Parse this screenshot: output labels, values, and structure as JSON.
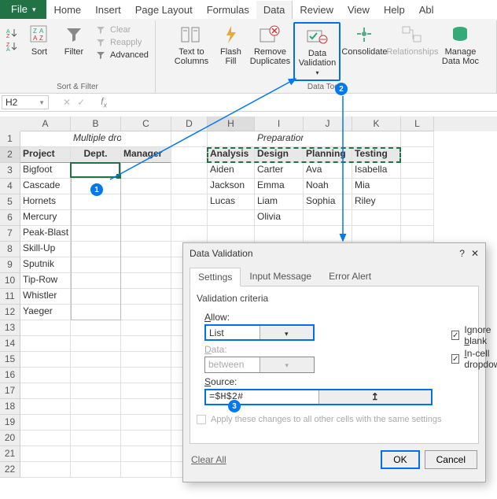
{
  "tabs": {
    "file": "File",
    "home": "Home",
    "insert": "Insert",
    "layout": "Page Layout",
    "formulas": "Formulas",
    "data": "Data",
    "review": "Review",
    "view": "View",
    "help": "Help",
    "abl": "Abl"
  },
  "ribbon": {
    "sort": "Sort",
    "filter": "Filter",
    "clear": "Clear",
    "reapply": "Reapply",
    "advanced": "Advanced",
    "group1": "Sort & Filter",
    "texttocol": "Text to\nColumns",
    "flashfill": "Flash\nFill",
    "removedup": "Remove\nDuplicates",
    "datavalidation": "Data\nValidation",
    "consolidate": "Consolidate",
    "relationships": "Relationships",
    "managedata": "Manage\nData Moc",
    "group2": "Data Tools"
  },
  "namebox": "H2",
  "cols": [
    "A",
    "B",
    "C",
    "D",
    "H",
    "I",
    "J",
    "K",
    "L"
  ],
  "table1": {
    "title": "Multiple drop-downs",
    "headers": [
      "Project",
      "Dept.",
      "Manager"
    ],
    "rows": [
      "Bigfoot",
      "Cascade",
      "Hornets",
      "Mercury",
      "Peak-Blast",
      "Skill-Up",
      "Sputnik",
      "Tip-Row",
      "Whistler",
      "Yaeger"
    ]
  },
  "table2": {
    "title": "Preparation table",
    "headers": [
      "Analysis",
      "Design",
      "Planning",
      "Testing"
    ],
    "rows": [
      [
        "Aiden",
        "Carter",
        "Ava",
        "Isabella"
      ],
      [
        "Jackson",
        "Emma",
        "Noah",
        "Mia"
      ],
      [
        "Lucas",
        "Liam",
        "Sophia",
        "Riley"
      ],
      [
        "",
        "Olivia",
        "",
        ""
      ]
    ]
  },
  "dialog": {
    "title": "Data Validation",
    "tabs": [
      "Settings",
      "Input Message",
      "Error Alert"
    ],
    "criteria": "Validation criteria",
    "allow_label": "Allow:",
    "allow_value": "List",
    "data_label": "Data:",
    "data_value": "between",
    "source_label": "Source:",
    "source_value": "=$H$2#",
    "ignore": "Ignore blank",
    "incell": "In-cell dropdown",
    "note": "Apply these changes to all other cells with the same settings",
    "clear": "Clear All",
    "ok": "OK",
    "cancel": "Cancel",
    "help": "?",
    "close": "✕"
  },
  "callouts": {
    "c1": "1",
    "c2": "2",
    "c3": "3"
  }
}
